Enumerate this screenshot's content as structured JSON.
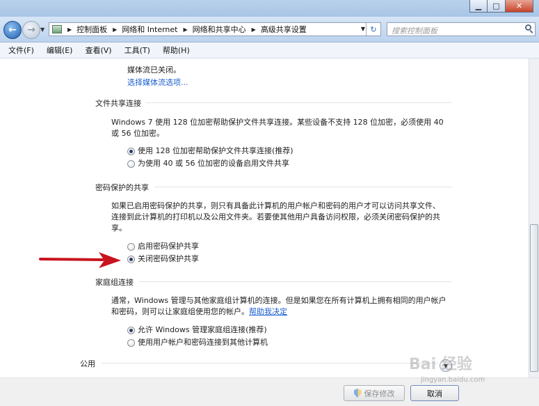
{
  "titlebar": {
    "minimize_glyph": "▁",
    "maximize_glyph": "□",
    "close_glyph": "✕"
  },
  "nav": {
    "back_glyph": "←",
    "forward_glyph": "→",
    "breadcrumbs": [
      "控制面板",
      "网络和 Internet",
      "网络和共享中心",
      "高级共享设置"
    ],
    "search_placeholder": "搜索控制面板",
    "icons": [
      "back-arrow-icon",
      "forward-arrow-icon",
      "control-panel-icon",
      "refresh-icon",
      "search-icon"
    ]
  },
  "menu": [
    "文件(F)",
    "编辑(E)",
    "查看(V)",
    "工具(T)",
    "帮助(H)"
  ],
  "media": {
    "status": "媒体流已关闭。",
    "link": "选择媒体流选项..."
  },
  "file_sharing": {
    "title": "文件共享连接",
    "desc_line1": "Windows 7 使用 128 位加密帮助保护文件共享连接。某些设备不支持 128 位加密，必须使用 40",
    "desc_line2": "或 56 位加密。",
    "options": [
      {
        "label": "使用 128 位加密帮助保护文件共享连接(推荐)",
        "selected": true
      },
      {
        "label": "为使用 40 或 56 位加密的设备启用文件共享",
        "selected": false
      }
    ]
  },
  "password_sharing": {
    "title": "密码保护的共享",
    "desc_line1": "如果已启用密码保护的共享，则只有具备此计算机的用户帐户和密码的用户才可以访问共享文件、",
    "desc_line2": "连接到此计算机的打印机以及公用文件夹。若要使其他用户具备访问权限，必须关闭密码保护的共",
    "desc_line3": "享。",
    "options": [
      {
        "label": "启用密码保护共享",
        "selected": false
      },
      {
        "label": "关闭密码保护共享",
        "selected": true
      }
    ]
  },
  "homegroup": {
    "title": "家庭组连接",
    "desc_line1": "通常，Windows 管理与其他家庭组计算机的连接。但是如果您在所有计算机上拥有相同的用户帐户",
    "desc_line2": "和密码，则可以让家庭组使用您的帐户。",
    "help_link": "帮助我决定",
    "options": [
      {
        "label": "允许 Windows 管理家庭组连接(推荐)",
        "selected": true
      },
      {
        "label": "使用用户帐户和密码连接到其他计算机",
        "selected": false
      }
    ]
  },
  "public": {
    "title": "公用",
    "expand_glyph": "▼"
  },
  "footer": {
    "save_label": "保存修改",
    "cancel_label": "取消"
  },
  "annotation_color": "#c8141e",
  "watermark": {
    "logo": "Bai 经验",
    "url": "jingyan.baidu.com"
  }
}
